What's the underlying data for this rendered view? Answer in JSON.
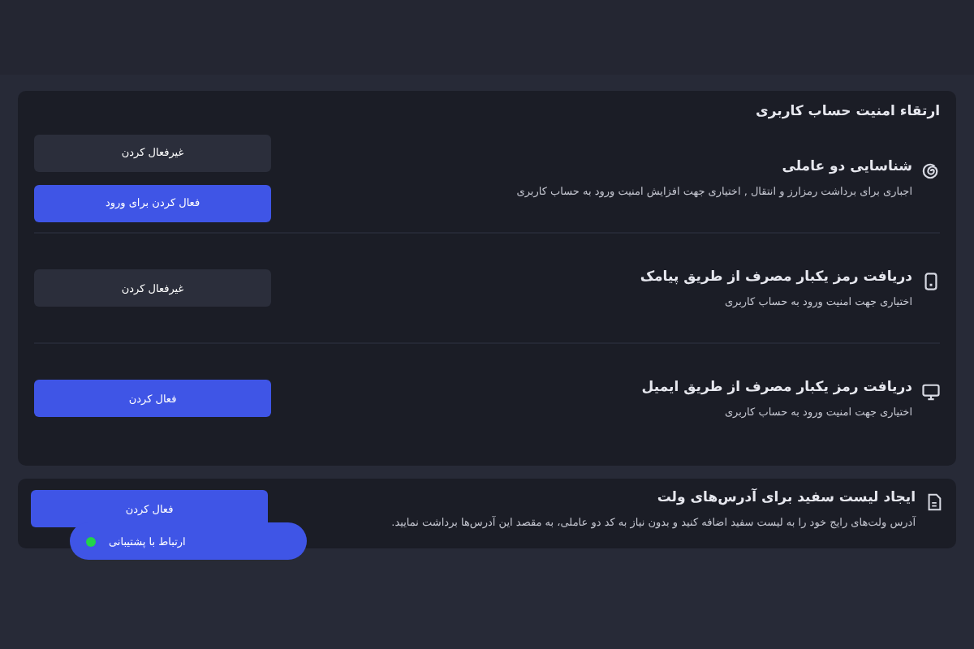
{
  "security_card": {
    "title": "ارتقاء امنیت حساب کاربری",
    "items": [
      {
        "kind": "spiral",
        "title": "شناسایی دو عاملی",
        "description": "اجباری برای برداشت رمزارز و انتقال , اختیاری جهت افزایش امنیت ورود به حساب کاربری",
        "buttons": [
          {
            "label": "غیرفعال کردن",
            "kind": "secondary"
          },
          {
            "label": "فعال کردن برای ورود",
            "kind": "primary"
          }
        ]
      },
      {
        "kind": "phone",
        "title": "دریافت رمز یکبار مصرف از طریق پیامک",
        "description": "اختیاری جهت امنیت ورود به حساب کاربری",
        "buttons": [
          {
            "label": "غیرفعال کردن",
            "kind": "secondary"
          }
        ]
      },
      {
        "kind": "monitor",
        "title": "دریافت رمز یکبار مصرف از طریق ایمیل",
        "description": "اختیاری جهت امنیت ورود به حساب کاربری",
        "buttons": [
          {
            "label": "فعال کردن",
            "kind": "primary"
          }
        ]
      }
    ]
  },
  "whitelist_card": {
    "kind": "document",
    "title": "ایجاد لیست سفید برای آدرس‌های ولت",
    "description": "آدرس ولت‌های رایج خود را به لیست سفید اضافه کنید و بدون نیاز به کد دو عاملی، به مقصد این آدرس‌ها برداشت نمایید.",
    "buttons": [
      {
        "label": "فعال کردن",
        "kind": "primary"
      }
    ]
  },
  "support_button": {
    "label": "ارتباط با پشتیبانی",
    "online": true
  }
}
